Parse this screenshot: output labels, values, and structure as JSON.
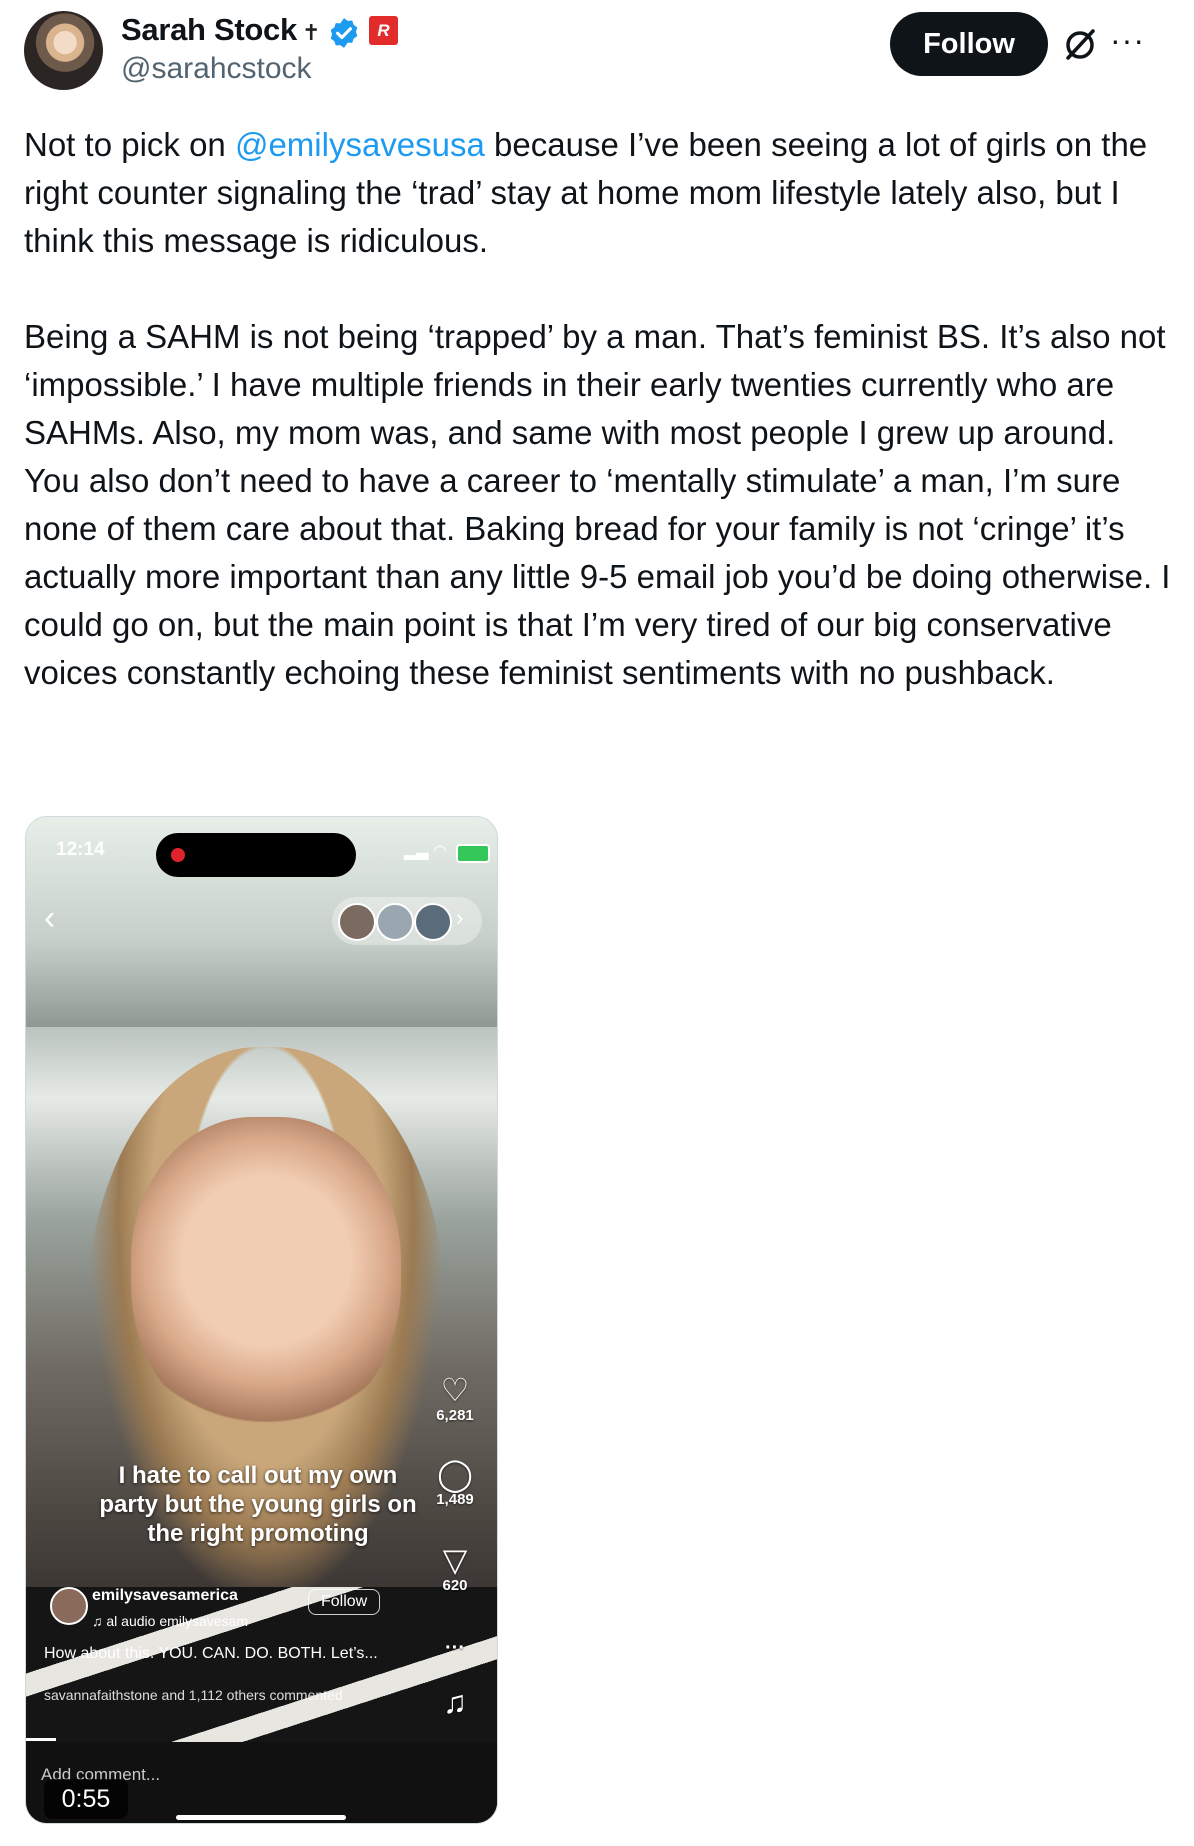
{
  "author": {
    "name": "Sarah Stock",
    "cross": "✝",
    "handle": "@sarahcstock",
    "follow_label": "Follow",
    "more_label": "···"
  },
  "tweet": {
    "line1_pre": "Not to pick on ",
    "mention": "@emilysavesusa",
    "line1_post": " because I’ve been seeing a lot of girls on the right counter signaling the ‘trad’ stay at home mom lifestyle lately also, but I think this message is ridiculous.",
    "para2": "Being a SAHM is not being ‘trapped’ by a man. That’s feminist BS. It’s also not ‘impossible.’ I have multiple friends in their early twenties currently who are SAHMs. Also, my mom was, and same with most people I grew up around.",
    "para3": "You also don’t need to have a career to ‘mentally stimulate’ a man, I’m sure none of them care about that. Baking bread for your family is not ‘cringe’ it’s actually more important than any little 9-5 email job you’d be doing otherwise. I could go on, but the main point is that I’m very tired of our big conservative voices constantly echoing these feminist sentiments with no pushback."
  },
  "media": {
    "time": "12:14",
    "caption": "I hate to call out my own party but the young girls on the right promoting",
    "likes": "6,281",
    "comments": "1,489",
    "shares": "620",
    "username": "emilysavesamerica",
    "follow": "Follow",
    "audio": "♫  al audio    emilysavesam",
    "description": "How about this. YOU. CAN. DO. BOTH. Let’s...",
    "commented": "savannafaithstone and 1,112 others commented",
    "add_comment": "Add comment...",
    "duration": "0:55"
  },
  "colors": {
    "accent": "#1d9bf0",
    "text": "#0f1419",
    "muted": "#536471",
    "verified": "#1d9bf0"
  }
}
